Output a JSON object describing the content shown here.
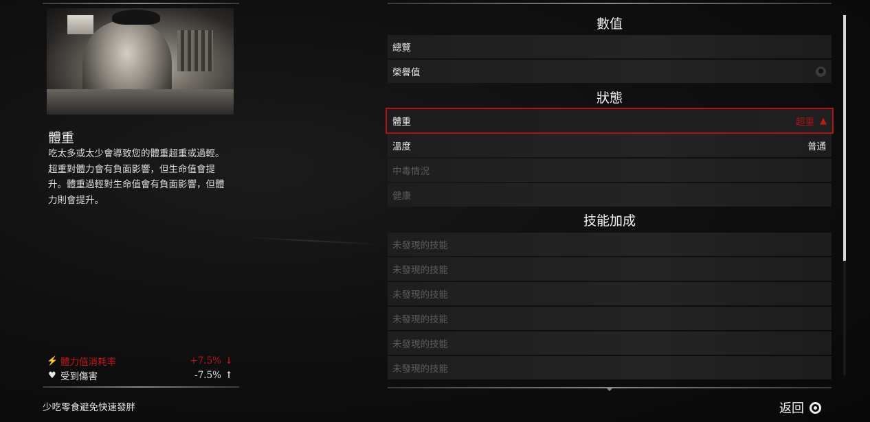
{
  "left": {
    "title": "體重",
    "description": "吃太多或太少會導致您的體重超重或過輕。超重對體力會有負面影響，但生命值會提升。體重過輕對生命值會有負面影響，但體力則會提升。",
    "effects": [
      {
        "icon": "lightning-icon",
        "label": "體力值消耗率",
        "value": "+7.5%",
        "arrow": "down-arrow-icon",
        "color": "#c0171c"
      },
      {
        "icon": "heart-icon",
        "label": "受到傷害",
        "value": "-7.5%",
        "arrow": "up-arrow-icon",
        "color": "#e8e8e8"
      }
    ],
    "hint": "少吃零食避免快速發胖"
  },
  "sections": {
    "stats": {
      "header": "數值",
      "rows": [
        {
          "label": "總覽",
          "value": ""
        },
        {
          "label": "榮譽值",
          "value": "",
          "icon": "honor-icon"
        }
      ]
    },
    "status": {
      "header": "狀態",
      "rows": [
        {
          "label": "體重",
          "value": "超重",
          "icon": "warning-icon",
          "selected": true
        },
        {
          "label": "溫度",
          "value": "普通"
        },
        {
          "label": "中毒情況",
          "value": "",
          "dim": true
        },
        {
          "label": "健康",
          "value": "",
          "dim": true
        }
      ]
    },
    "skills": {
      "header": "技能加成",
      "rows": [
        {
          "label": "未發現的技能",
          "dim": true
        },
        {
          "label": "未發現的技能",
          "dim": true
        },
        {
          "label": "未發現的技能",
          "dim": true
        },
        {
          "label": "未發現的技能",
          "dim": true
        },
        {
          "label": "未發現的技能",
          "dim": true
        },
        {
          "label": "未發現的技能",
          "dim": true
        }
      ]
    }
  },
  "scroll": {
    "position": 0.68
  },
  "footer": {
    "back_label": "返回"
  },
  "colors": {
    "accent_red": "#c0171c",
    "background": "#0b0b0b"
  }
}
